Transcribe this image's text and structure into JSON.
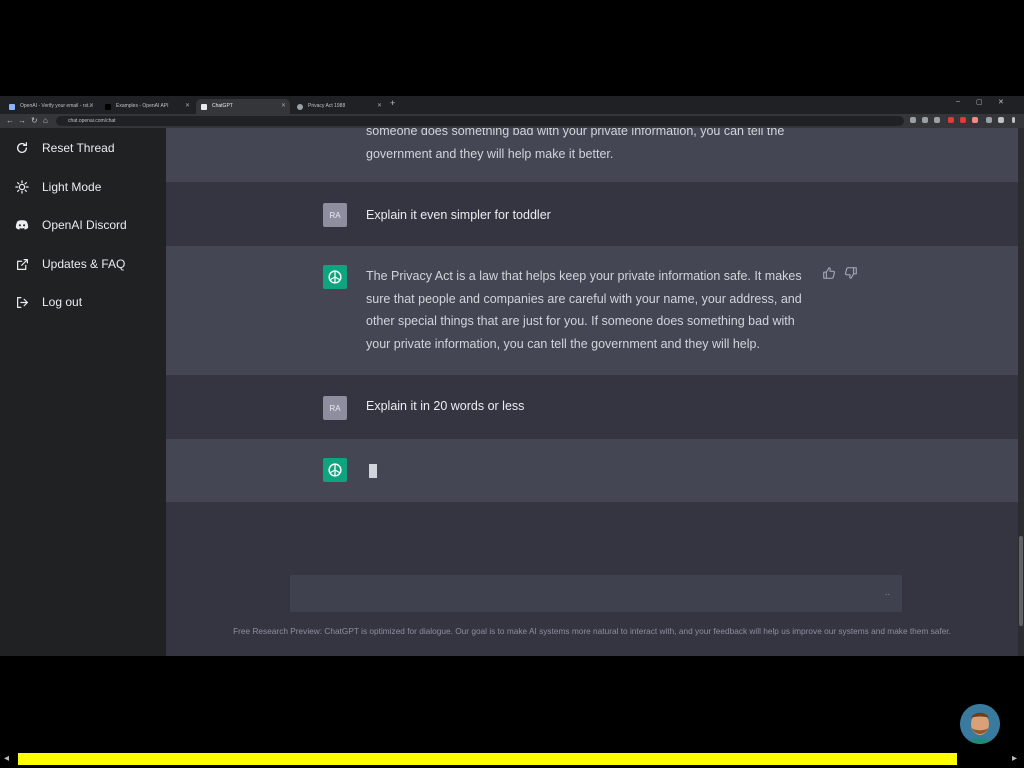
{
  "browser": {
    "tabs": [
      {
        "title": "OpenAI - Verify your email - rst..."
      },
      {
        "title": "Examples - OpenAI API"
      },
      {
        "title": "ChatGPT"
      },
      {
        "title": "Privacy Act 1988"
      }
    ],
    "new_tab": "+",
    "window_controls": {
      "minimize": "–",
      "maximize": "▢",
      "close": "✕"
    },
    "url": "chat.openai.com/chat",
    "nav": {
      "back": "←",
      "forward": "→",
      "reload": "↻",
      "home": "⌂"
    }
  },
  "sidebar": {
    "items": [
      {
        "label": "Reset Thread",
        "icon": "refresh-icon"
      },
      {
        "label": "Light Mode",
        "icon": "sun-icon"
      },
      {
        "label": "OpenAI Discord",
        "icon": "discord-icon"
      },
      {
        "label": "Updates & FAQ",
        "icon": "external-link-icon"
      },
      {
        "label": "Log out",
        "icon": "logout-icon"
      }
    ]
  },
  "conversation": {
    "partial_ai_message": "someone does something bad with your private information, you can tell the government and they will help make it better.",
    "user_avatar_initials": "RA",
    "messages": [
      {
        "role": "user",
        "text": "Explain it even simpler for toddler"
      },
      {
        "role": "assistant",
        "text": "The Privacy Act is a law that helps keep your private information safe. It makes sure that people and companies are careful with your name, your address, and other special things that are just for you. If someone does something bad with your private information, you can tell the government and they will help."
      },
      {
        "role": "user",
        "text": "Explain it in 20 words or less"
      },
      {
        "role": "assistant",
        "text": ""
      }
    ]
  },
  "input": {
    "placeholder": "",
    "send_glyph": ".."
  },
  "footer": {
    "text": "Free Research Preview: ChatGPT is optimized for dialogue. Our goal is to make AI systems more natural to interact with, and your feedback will help us improve our systems and make them safer."
  },
  "video": {
    "progress": 0.95,
    "prev_glyph": "◂",
    "next_glyph": "▸"
  },
  "colors": {
    "accent": "#10a37f",
    "progress": "#ffff00",
    "sidebar": "#202123",
    "main": "#343541",
    "ai_band": "#444654"
  }
}
